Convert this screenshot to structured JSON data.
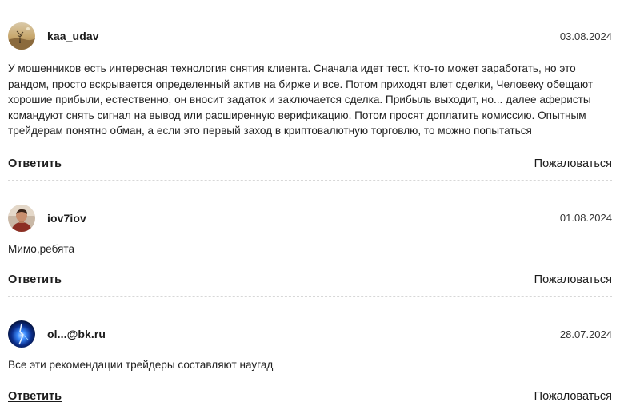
{
  "comments": [
    {
      "username": "kaa_udav",
      "date": "03.08.2024",
      "avatar_icon": "user-avatar-desert-photo",
      "text": "У мошенников есть интересная технология снятия клиента. Сначала идет тест. Кто-то может заработать, но это рандом, просто вскрывается определенный актив на бирже и все. Потом приходят влет сделки, Человеку обещают хорошие прибыли, естественно, он вносит задаток и заключается сделка. Прибыль выходит, но... далее аферисты командуют снять сигнал на вывод или расширенную верификацию. Потом просят доплатить комиссию. Опытным трейдерам понятно обман, а если это первый заход в криптовалютную торговлю, то можно попытаться",
      "reply_label": "Ответить",
      "report_label": "Пожаловаться"
    },
    {
      "username": "iov7iov",
      "date": "01.08.2024",
      "avatar_icon": "user-avatar-person-photo",
      "text": "Мимо,ребята",
      "reply_label": "Ответить",
      "report_label": "Пожаловаться"
    },
    {
      "username": "ol...@bk.ru",
      "date": "28.07.2024",
      "avatar_icon": "user-avatar-blue-light-photo",
      "text": "Все эти рекомендации трейдеры составляют наугад",
      "reply_label": "Ответить",
      "report_label": "Пожаловаться"
    }
  ]
}
